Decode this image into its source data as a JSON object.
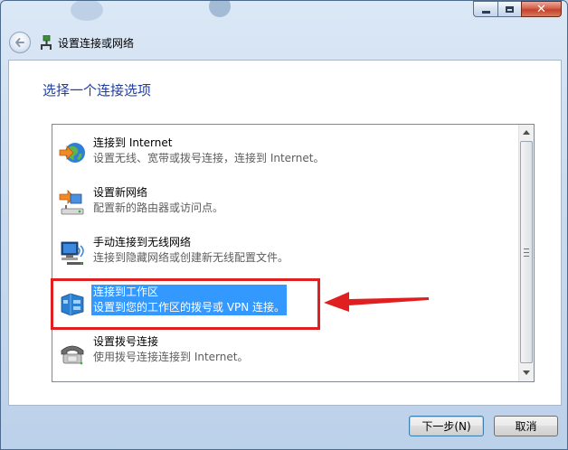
{
  "window": {
    "title": "设置连接或网络",
    "close_glyph": "✕"
  },
  "main": {
    "heading": "选择一个连接选项",
    "options": [
      {
        "title": "连接到 Internet",
        "description": "设置无线、宽带或拨号连接，连接到 Internet。",
        "icon": "globe-icon"
      },
      {
        "title": "设置新网络",
        "description": "配置新的路由器或访问点。",
        "icon": "router-icon"
      },
      {
        "title": "手动连接到无线网络",
        "description": "连接到隐藏网络或创建新无线配置文件。",
        "icon": "wireless-computer-icon"
      },
      {
        "title": "连接到工作区",
        "description": "设置到您的工作区的拨号或 VPN 连接。",
        "icon": "workplace-icon",
        "selected": true
      },
      {
        "title": "设置拨号连接",
        "description": "使用拨号连接连接到 Internet。",
        "icon": "dialup-phone-icon"
      }
    ]
  },
  "footer": {
    "next_label": "下一步(N)",
    "cancel_label": "取消"
  },
  "colors": {
    "accent": "#3399ff",
    "heading": "#1f3e9e",
    "annotation": "#e02020"
  }
}
